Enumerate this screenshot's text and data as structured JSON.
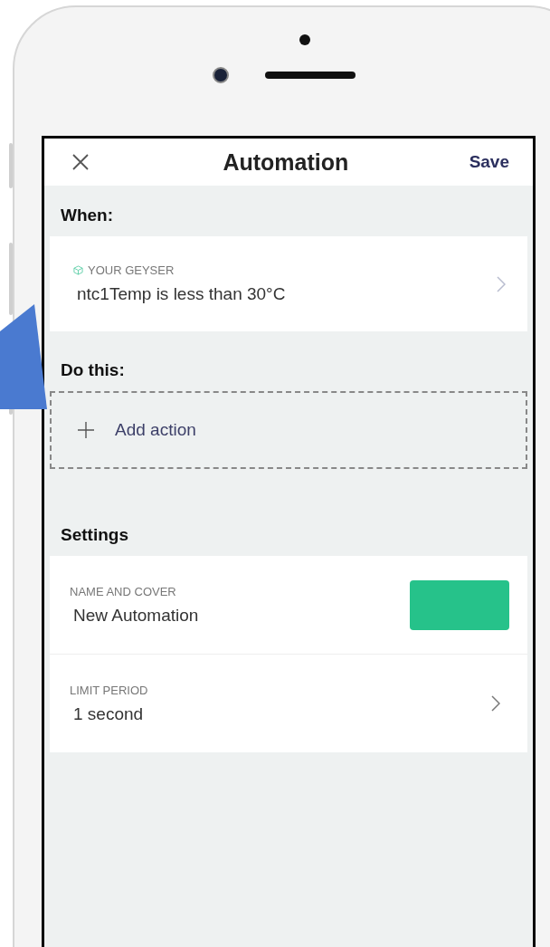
{
  "header": {
    "title": "Automation",
    "save": "Save"
  },
  "when": {
    "heading": "When:",
    "trigger": {
      "device": "YOUR GEYSER",
      "condition": "ntc1Temp is less than 30°C"
    }
  },
  "do_this": {
    "heading": "Do this:",
    "add_action": "Add action"
  },
  "settings": {
    "heading": "Settings",
    "rows": [
      {
        "kind": "cover",
        "label": "NAME AND COVER",
        "value": "New Automation"
      },
      {
        "kind": "link",
        "label": "LIMIT PERIOD",
        "value": "1 second"
      }
    ]
  }
}
